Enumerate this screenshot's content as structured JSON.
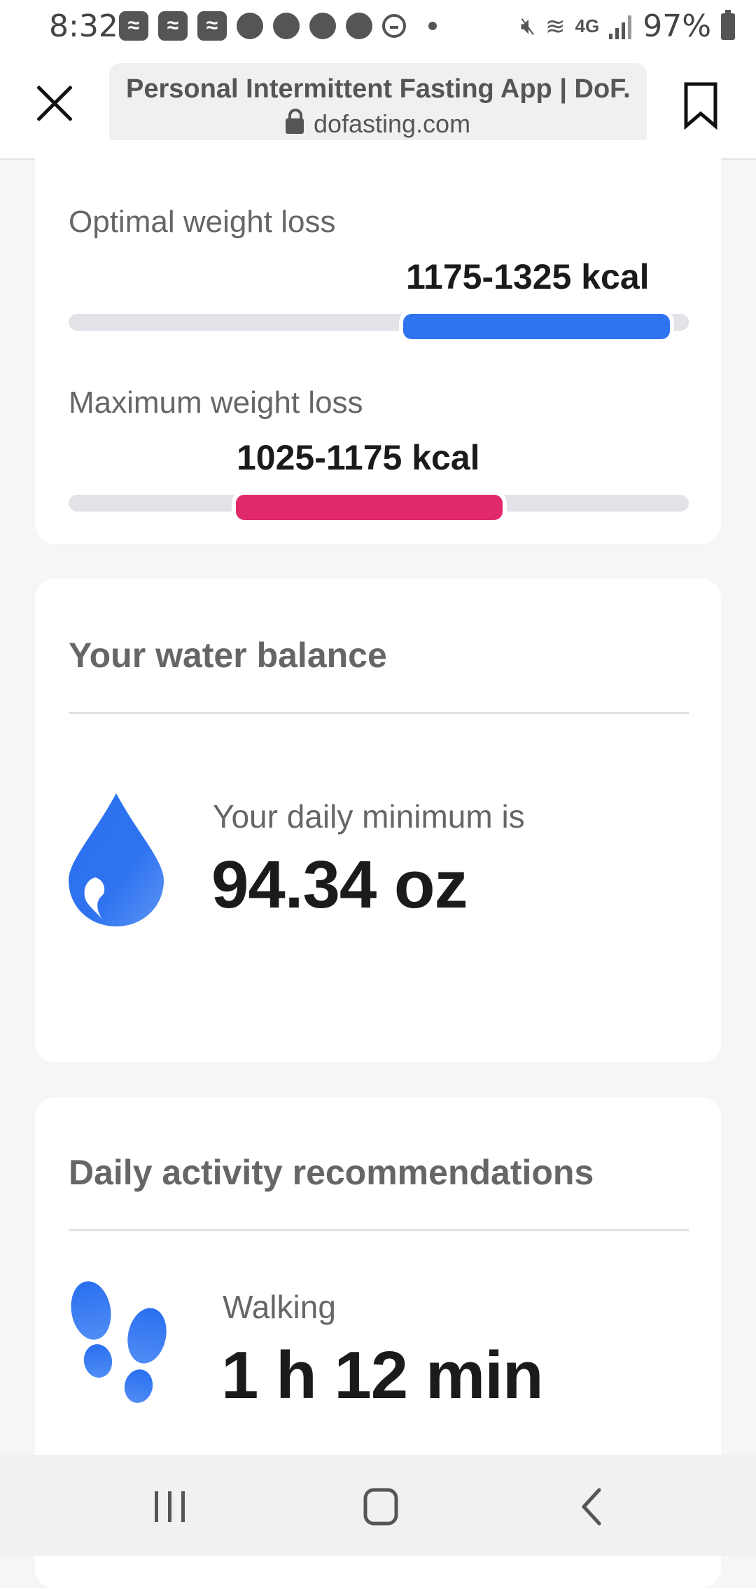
{
  "status_bar": {
    "time": "8:32",
    "battery_percent": "97%",
    "network": "4G",
    "icons": [
      "app-notification-icon",
      "app-notification-icon",
      "app-notification-icon",
      "account-icon",
      "photo-icon",
      "photo-icon",
      "alert-icon",
      "do-not-disturb-icon",
      "mute-icon",
      "wifi-icon",
      "signal-icon",
      "battery-icon"
    ]
  },
  "browser": {
    "page_title": "Personal Intermittent Fasting App | DoF...",
    "url": "dofasting.com"
  },
  "calories": {
    "optimal": {
      "label": "Optimal weight loss",
      "range": "1175-1325 kcal",
      "fill_start": 0.54,
      "fill_end": 0.97,
      "color": "#2f73f0"
    },
    "maximum": {
      "label": "Maximum weight loss",
      "range": "1025-1175 kcal",
      "fill_start": 0.27,
      "fill_end": 0.7,
      "color": "#e0296b"
    }
  },
  "water": {
    "title": "Your water balance",
    "subtitle": "Your daily minimum is",
    "value": "94.34 oz",
    "icon": "water-drop-icon"
  },
  "activity": {
    "title": "Daily activity recommendations",
    "item_label": "Walking",
    "item_value": "1 h 12 min",
    "icon": "footprints-icon"
  },
  "nav": {
    "icons": [
      "recent-apps-icon",
      "home-icon",
      "back-icon"
    ]
  }
}
